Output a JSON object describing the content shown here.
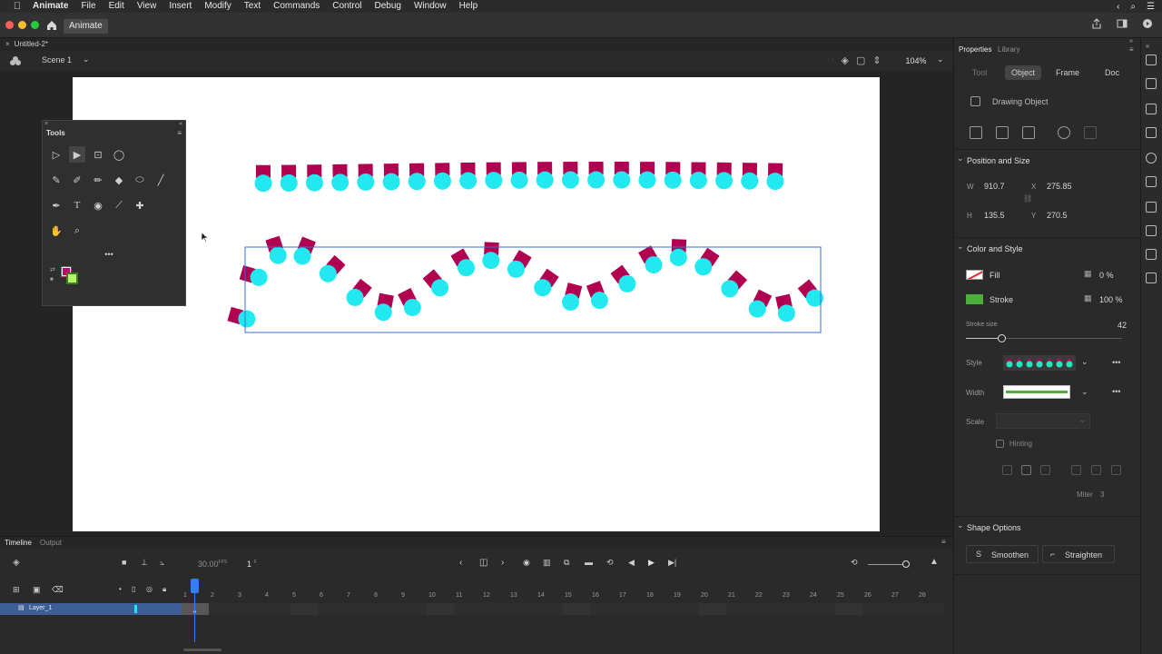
{
  "menubar": {
    "app": "Animate",
    "items": [
      "File",
      "Edit",
      "View",
      "Insert",
      "Modify",
      "Text",
      "Commands",
      "Control",
      "Debug",
      "Window",
      "Help"
    ]
  },
  "titlebar": {
    "tab": "Animate"
  },
  "document": {
    "tab": "Untitled-2*"
  },
  "scene": {
    "label": "Scene 1",
    "zoom": "104%"
  },
  "tools": {
    "title": "Tools"
  },
  "properties": {
    "tabs": {
      "properties": "Properties",
      "library": "Library"
    },
    "subtabs": {
      "tool": "Tool",
      "object": "Object",
      "frame": "Frame",
      "doc": "Doc"
    },
    "object_type": "Drawing Object",
    "position_size": {
      "title": "Position and Size",
      "w_label": "W",
      "w": "910.7",
      "x_label": "X",
      "x": "275.85",
      "h_label": "H",
      "h": "135.5",
      "y_label": "Y",
      "y": "270.5"
    },
    "color_style": {
      "title": "Color and Style",
      "fill_label": "Fill",
      "fill_pct": "0 %",
      "stroke_label": "Stroke",
      "stroke_pct": "100 %",
      "stroke_size_label": "Stroke size",
      "stroke_size": "42",
      "style_label": "Style",
      "width_label": "Width",
      "scale_label": "Scale",
      "hinting_label": "Hinting",
      "miter_label": "Miter",
      "miter": "3",
      "stroke_color": "#4caf3c"
    },
    "shape_options": {
      "title": "Shape Options",
      "smoothen": "Smoothen",
      "straighten": "Straighten"
    }
  },
  "timeline": {
    "tabs": {
      "timeline": "Timeline",
      "output": "Output"
    },
    "fps": "30.00",
    "fps_unit": "FPS",
    "frame": "1",
    "frame_unit": "F",
    "ruler": [
      "1",
      "2",
      "3",
      "4",
      "5",
      "6",
      "7",
      "8",
      "9",
      "10",
      "11",
      "12",
      "13",
      "14",
      "15",
      "16",
      "17",
      "18",
      "19",
      "20",
      "21",
      "22",
      "23",
      "24",
      "25",
      "26",
      "27",
      "28"
    ],
    "layer_name": "Layer_1"
  },
  "colors": {
    "dash": "#b0004f",
    "dot": "#22e8f0",
    "selection": "#3a6fd8"
  }
}
